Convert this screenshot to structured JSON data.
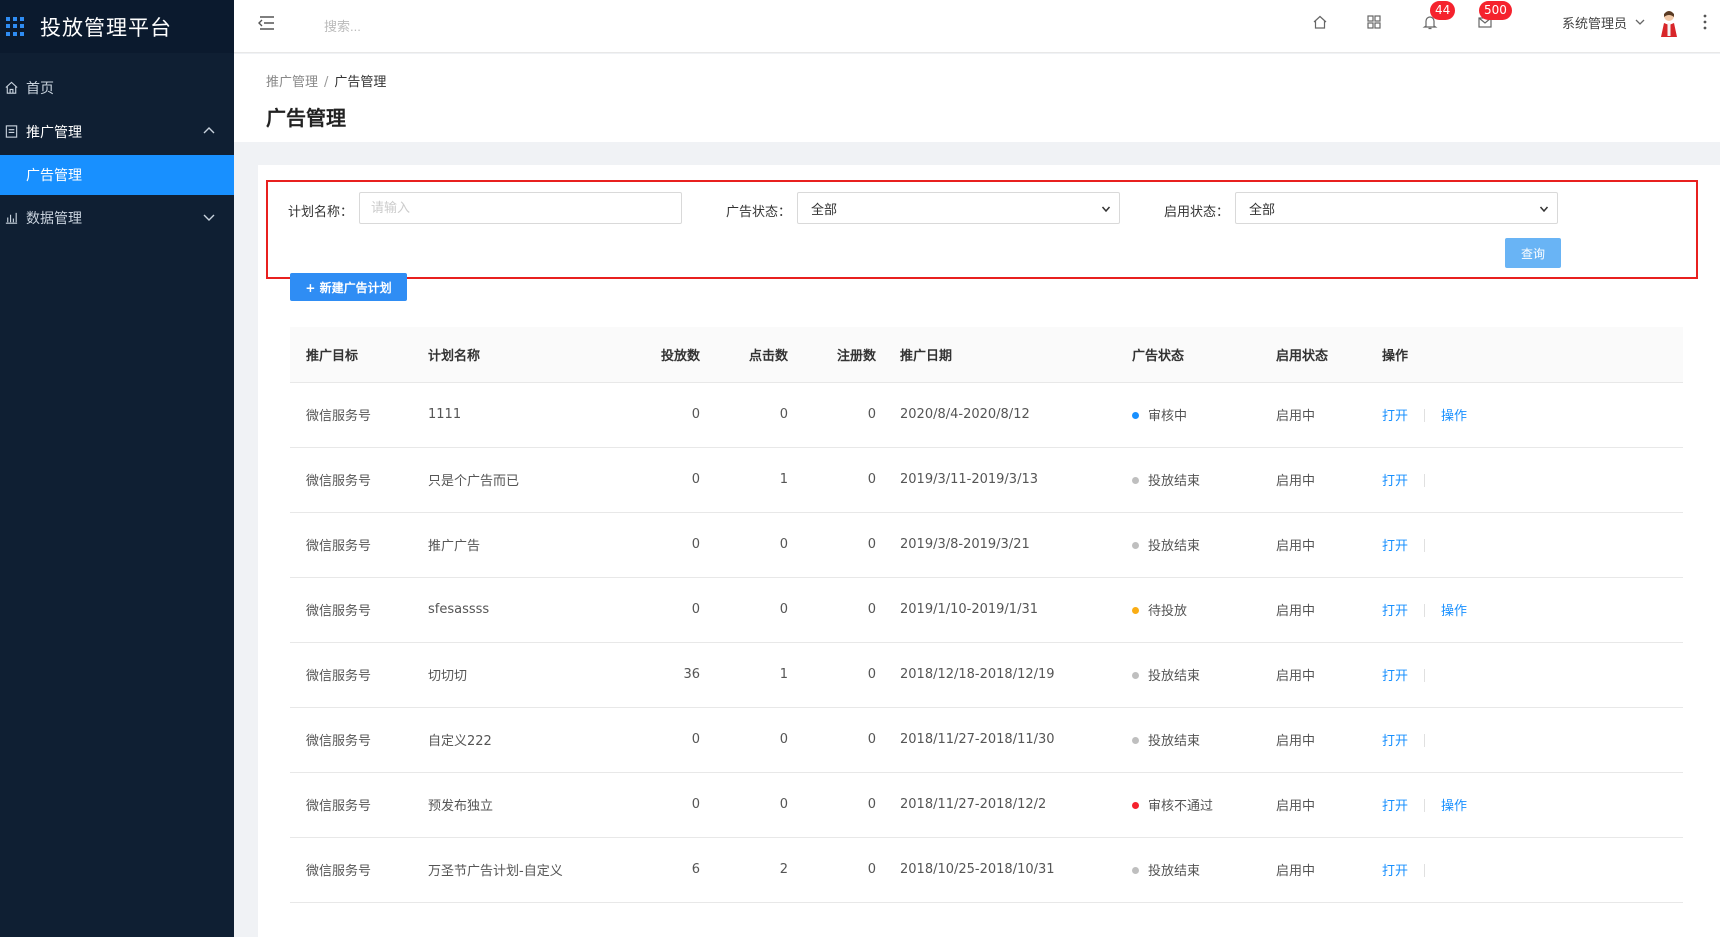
{
  "app": {
    "title": "投放管理平台"
  },
  "sidebar": {
    "items": [
      {
        "label": "首页"
      },
      {
        "label": "推广管理"
      },
      {
        "label": "广告管理"
      },
      {
        "label": "数据管理"
      }
    ]
  },
  "header": {
    "search_placeholder": "搜索...",
    "notifications_count": "44",
    "messages_count": "500",
    "user_name": "系统管理员"
  },
  "breadcrumb": {
    "parent": "推广管理",
    "separator": "/",
    "current": "广告管理"
  },
  "page": {
    "title": "广告管理"
  },
  "filter": {
    "plan_name_label": "计划名称：",
    "plan_name_placeholder": "请输入",
    "ad_status_label": "广告状态：",
    "ad_status_value": "全部",
    "enable_status_label": "启用状态：",
    "enable_status_value": "全部",
    "query_label": "查询"
  },
  "toolbar": {
    "new_label": "+ 新建广告计划"
  },
  "table": {
    "columns": [
      "推广目标",
      "计划名称",
      "投放数",
      "点击数",
      "注册数",
      "推广日期",
      "广告状态",
      "启用状态",
      "操作"
    ],
    "rows": [
      {
        "target": "微信服务号",
        "name": "1111",
        "placed": "0",
        "clicks": "0",
        "regs": "0",
        "date": "2020/8/4-2020/8/12",
        "status": "审核中",
        "status_color": "#1890ff",
        "enabled": "启用中",
        "op1": "打开",
        "op2": "操作"
      },
      {
        "target": "微信服务号",
        "name": "只是个广告而已",
        "placed": "0",
        "clicks": "1",
        "regs": "0",
        "date": "2019/3/11-2019/3/13",
        "status": "投放结束",
        "status_color": "#bfbfbf",
        "enabled": "启用中",
        "op1": "打开",
        "op2": ""
      },
      {
        "target": "微信服务号",
        "name": "推广广告",
        "placed": "0",
        "clicks": "0",
        "regs": "0",
        "date": "2019/3/8-2019/3/21",
        "status": "投放结束",
        "status_color": "#bfbfbf",
        "enabled": "启用中",
        "op1": "打开",
        "op2": ""
      },
      {
        "target": "微信服务号",
        "name": "sfesassss",
        "placed": "0",
        "clicks": "0",
        "regs": "0",
        "date": "2019/1/10-2019/1/31",
        "status": "待投放",
        "status_color": "#faad14",
        "enabled": "启用中",
        "op1": "打开",
        "op2": "操作"
      },
      {
        "target": "微信服务号",
        "name": "切切切",
        "placed": "36",
        "clicks": "1",
        "regs": "0",
        "date": "2018/12/18-2018/12/19",
        "status": "投放结束",
        "status_color": "#bfbfbf",
        "enabled": "启用中",
        "op1": "打开",
        "op2": ""
      },
      {
        "target": "微信服务号",
        "name": "自定义222",
        "placed": "0",
        "clicks": "0",
        "regs": "0",
        "date": "2018/11/27-2018/11/30",
        "status": "投放结束",
        "status_color": "#bfbfbf",
        "enabled": "启用中",
        "op1": "打开",
        "op2": ""
      },
      {
        "target": "微信服务号",
        "name": "预发布独立",
        "placed": "0",
        "clicks": "0",
        "regs": "0",
        "date": "2018/11/27-2018/12/2",
        "status": "审核不通过",
        "status_color": "#f5222d",
        "enabled": "启用中",
        "op1": "打开",
        "op2": "操作"
      },
      {
        "target": "微信服务号",
        "name": "万圣节广告计划-自定义",
        "placed": "6",
        "clicks": "2",
        "regs": "0",
        "date": "2018/10/25-2018/10/31",
        "status": "投放结束",
        "status_color": "#bfbfbf",
        "enabled": "启用中",
        "op1": "打开",
        "op2": ""
      }
    ]
  }
}
